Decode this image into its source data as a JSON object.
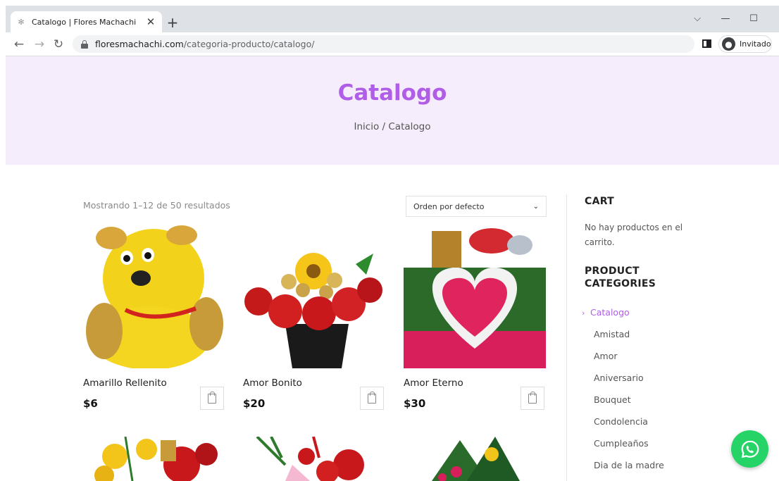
{
  "browser": {
    "tab_title": "Catalogo | Flores Machachi",
    "url_host": "floresmachachi.com",
    "url_path": "/categoria-producto/catalogo/",
    "profile_label": "Invitado"
  },
  "hero": {
    "title": "Catalogo",
    "breadcrumb": "Inicio / Catalogo",
    "title_color": "#b05ee8",
    "background": "#f6edfc"
  },
  "shop": {
    "result_count": "Mostrando 1–12 de 50 resultados",
    "orderby_selected": "Orden por defecto",
    "products": [
      {
        "title": "Amarillo Rellenito",
        "price": "$6"
      },
      {
        "title": "Amor Bonito",
        "price": "$20"
      },
      {
        "title": "Amor Eterno",
        "price": "$30"
      }
    ]
  },
  "sidebar": {
    "cart_title": "CART",
    "cart_empty": "No hay productos en el carrito.",
    "categories_title_line1": "PRODUCT",
    "categories_title_line2": "CATEGORIES",
    "categories": [
      "Catalogo",
      "Amistad",
      "Amor",
      "Aniversario",
      "Bouquet",
      "Condolencia",
      "Cumpleaños",
      "Dia de la madre"
    ]
  },
  "colors": {
    "accent": "#b05ee8",
    "whatsapp": "#25d366"
  }
}
